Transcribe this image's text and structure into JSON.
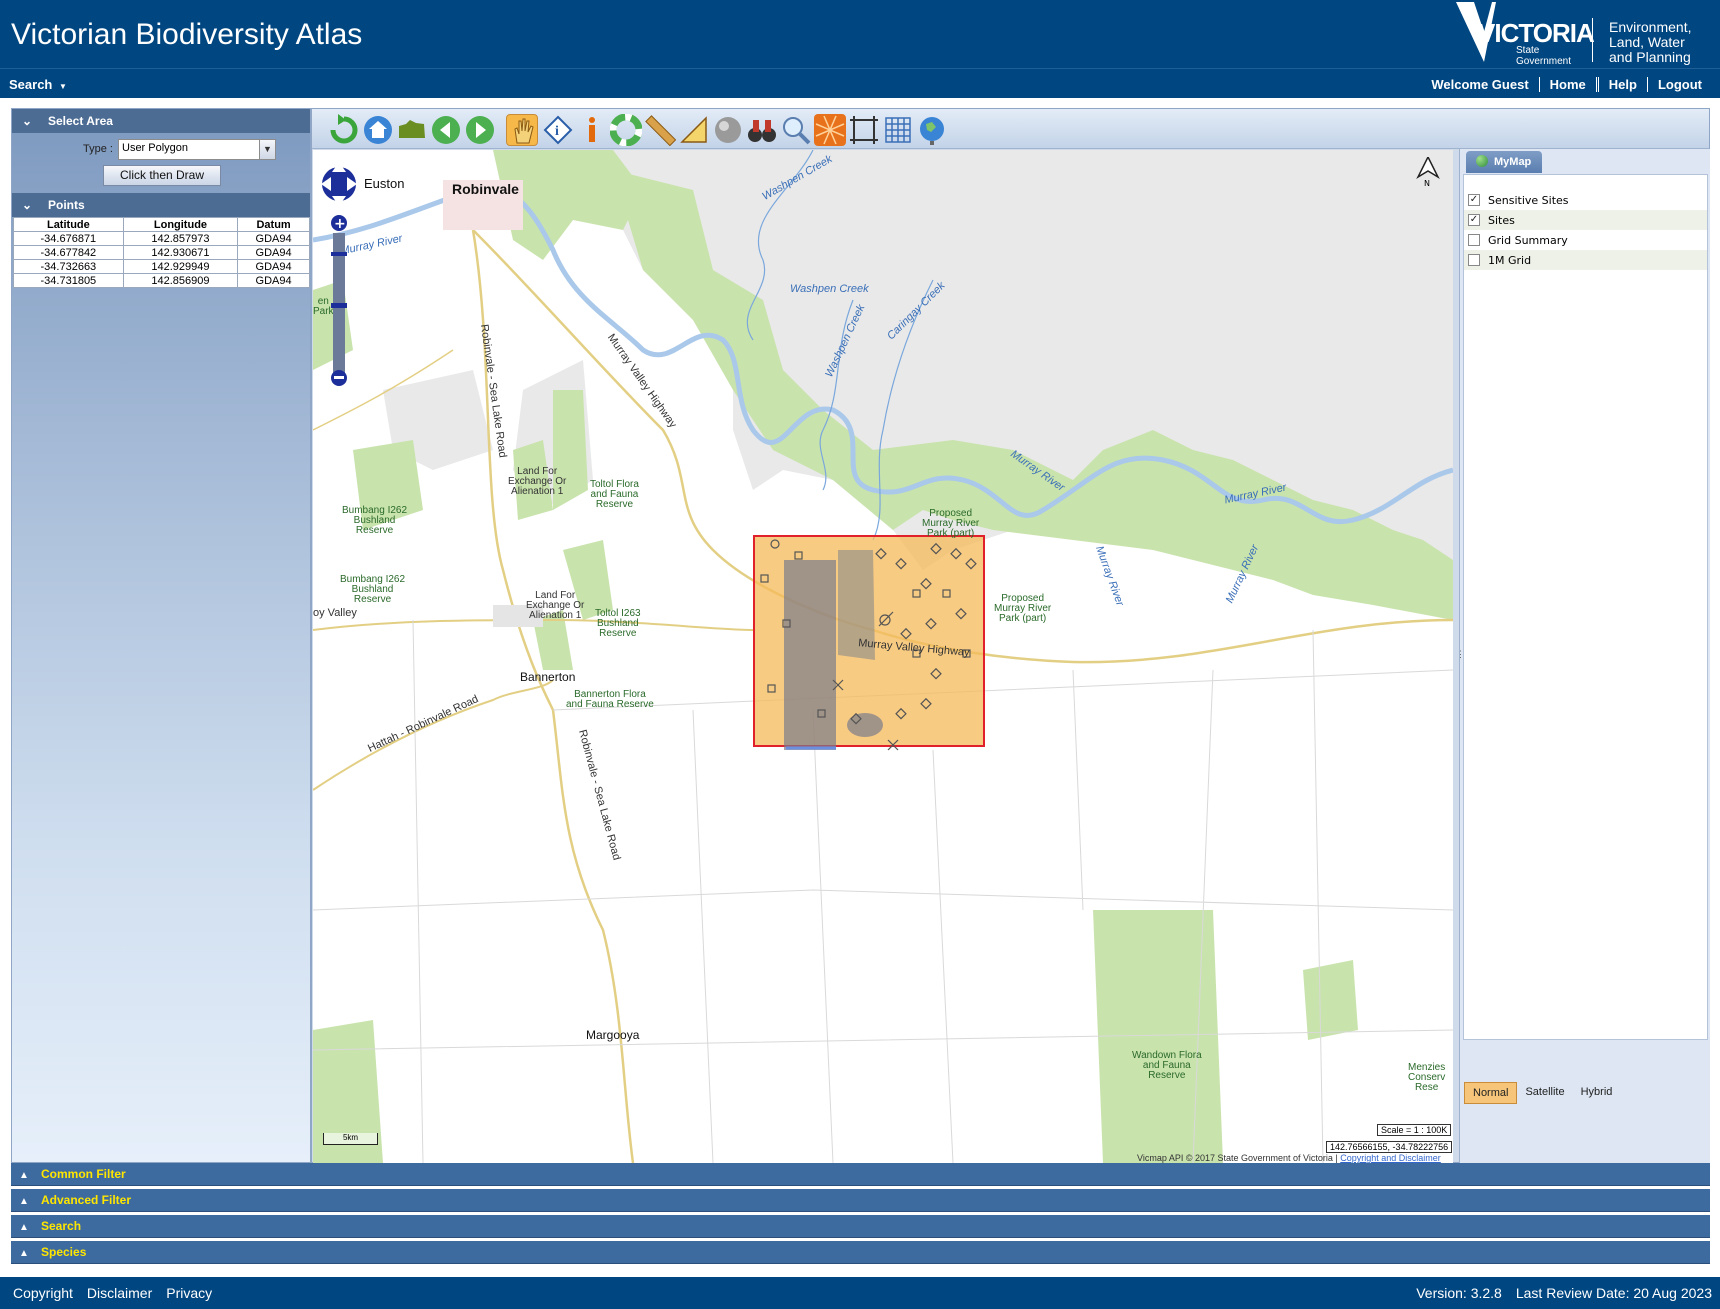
{
  "header": {
    "title": "Victorian Biodiversity Atlas",
    "logo_word": "VICTORIA",
    "logo_sub_1": "State",
    "logo_sub_2": "Government",
    "dept_line1": "Environment,",
    "dept_line2": "Land, Water",
    "dept_line3": "and Planning"
  },
  "nav": {
    "search_label": "Search",
    "welcome": "Welcome Guest",
    "home": "Home",
    "help": "Help",
    "logout": "Logout"
  },
  "select_area": {
    "title": "Select Area",
    "type_label": "Type :",
    "type_value": "User Polygon",
    "draw_button": "Click then Draw"
  },
  "points": {
    "title": "Points",
    "headers": [
      "Latitude",
      "Longitude",
      "Datum"
    ],
    "rows": [
      [
        "-34.676871",
        "142.857973",
        "GDA94"
      ],
      [
        "-34.677842",
        "142.930671",
        "GDA94"
      ],
      [
        "-34.732663",
        "142.929949",
        "GDA94"
      ],
      [
        "-34.731805",
        "142.856909",
        "GDA94"
      ]
    ]
  },
  "toolbar": {
    "tools": [
      "refresh-icon",
      "home-icon",
      "full-extent-icon",
      "back-icon",
      "forward-icon",
      "pan-hand-icon",
      "identify-icon",
      "info-icon",
      "help-ring-icon",
      "measure-ruler-icon",
      "measure-area-icon",
      "clear-icon",
      "find-binoculars-icon",
      "zoom-search-icon",
      "coordinates-icon",
      "select-extent-icon",
      "grid-icon",
      "globe-icon"
    ]
  },
  "map": {
    "labels": {
      "euston": "Euston",
      "robinvale": "Robinvale",
      "murray_river_1": "Murray River",
      "murray_river_2": "Murray River",
      "murray_river_3": "Murray River",
      "murray_river_4": "Murray River",
      "murray_river_5": "Murray River",
      "washpen_1": "Washpen Creek",
      "washpen_2": "Washpen Creek",
      "washpen_3": "Washpen Creek",
      "caringay": "Caringay Creek",
      "mvh_1": "Murray Valley Highway",
      "mvh_2": "Murray Valley Highway",
      "robinvale_sea_lake_1": "Robinvale - Sea Lake Road",
      "robinvale_sea_lake_2": "Robinvale - Sea Lake Road",
      "hattah_robinvale": "Hattah - Robinvale Road",
      "land_exchange_1_a": "Land For",
      "land_exchange_1_b": "Exchange Or",
      "land_exchange_1_c": "Alienation 1",
      "land_exchange_2_a": "Land For",
      "land_exchange_2_b": "Exchange Or",
      "land_exchange_2_c": "Alienation 1",
      "toltol_a": "Toltol Flora",
      "toltol_b": "and Fauna",
      "toltol_c": "Reserve",
      "toltol_i263_a": "Toltol I263",
      "toltol_i263_b": "Bushland",
      "toltol_i263_c": "Reserve",
      "bumbang1_a": "Bumbang I262",
      "bumbang1_b": "Bushland",
      "bumbang1_c": "Reserve",
      "bumbang2_a": "Bumbang I262",
      "bumbang2_b": "Bushland",
      "bumbang2_c": "Reserve",
      "proposed1_a": "Proposed",
      "proposed1_b": "Murray River",
      "proposed1_c": "Park (part)",
      "proposed2_a": "Proposed",
      "proposed2_b": "Murray River",
      "proposed2_c": "Park (part)",
      "bannerton": "Bannerton",
      "bannerton_ffr_a": "Bannerton Flora",
      "bannerton_ffr_b": "and Fauna Reserve",
      "margooya": "Margooya",
      "wandown_a": "Wandown Flora",
      "wandown_b": "and Fauna",
      "wandown_c": "Reserve",
      "menzies_a": "Menzies",
      "menzies_b": "Conserv",
      "menzies_c": "Rese",
      "valley": "oy Valley",
      "en_park_a": "en",
      "en_park_b": "Park"
    },
    "scale": "Scale = 1 : 100K",
    "coords": "142.76566155, -34.78222756",
    "copyright": "Vicmap API © 2017 State Government of Victoria |",
    "copyright_link": "Copyright and Disclaimer",
    "north": "N",
    "scalebar": "5km"
  },
  "mymap": {
    "tab": "MyMap",
    "layers": [
      {
        "label": "Sensitive Sites",
        "checked": true
      },
      {
        "label": "Sites",
        "checked": true
      },
      {
        "label": "Grid Summary",
        "checked": false
      },
      {
        "label": "1M Grid",
        "checked": false
      }
    ],
    "map_types": [
      "Normal",
      "Satellite",
      "Hybrid"
    ],
    "active_map_type": "Normal"
  },
  "accordions": [
    "Common Filter",
    "Advanced Filter",
    "Search",
    "Species"
  ],
  "footer": {
    "copyright": "Copyright",
    "disclaimer": "Disclaimer",
    "privacy": "Privacy",
    "version": "Version: 3.2.8",
    "review": "Last Review Date: 20 Aug 2023"
  },
  "colors": {
    "header_blue": "#004680",
    "accordion_blue": "#3d6a9f",
    "accordion_text": "#ffe600",
    "polygon_fill": "#f5b95a",
    "polygon_border": "#e0202a",
    "park_green": "#c9e3ad",
    "river_blue": "#a9c8ea"
  }
}
